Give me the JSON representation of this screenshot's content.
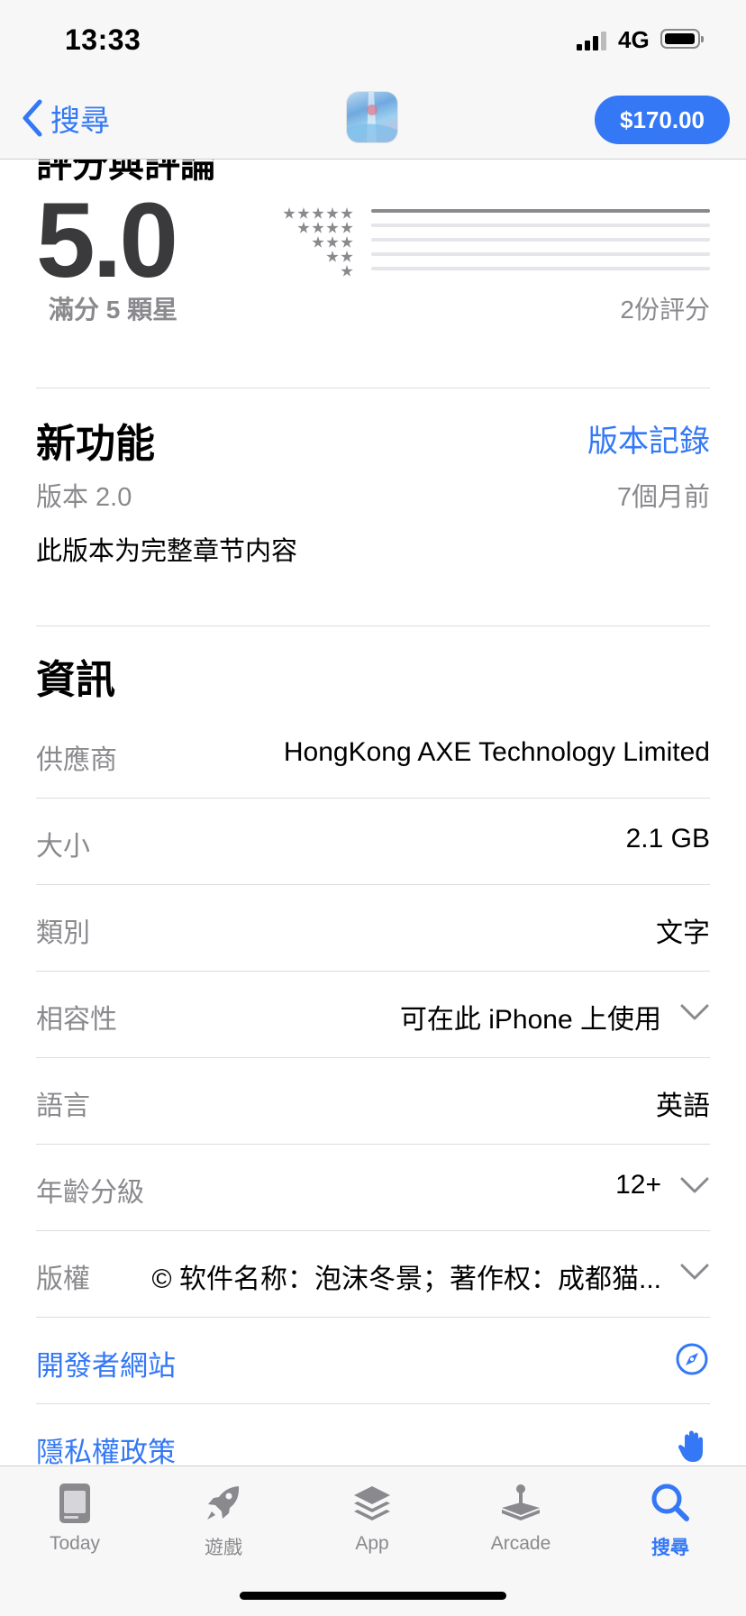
{
  "status_bar": {
    "time": "13:33",
    "network": "4G"
  },
  "nav": {
    "back_label": "搜尋",
    "price": "$170.00"
  },
  "ratings": {
    "section_title": "評分與評論",
    "average": "5.0",
    "out_of": "滿分 5 顆星",
    "count": "2份評分",
    "distribution": [
      {
        "stars": 5,
        "fraction": 1.0
      },
      {
        "stars": 4,
        "fraction": 0.0
      },
      {
        "stars": 3,
        "fraction": 0.0
      },
      {
        "stars": 2,
        "fraction": 0.0
      },
      {
        "stars": 1,
        "fraction": 0.0
      }
    ]
  },
  "whats_new": {
    "title": "新功能",
    "history_link": "版本記錄",
    "version": "版本 2.0",
    "date": "7個月前",
    "notes": "此版本为完整章节内容"
  },
  "info": {
    "title": "資訊",
    "rows": [
      {
        "label": "供應商",
        "value": "HongKong AXE Technology Limited"
      },
      {
        "label": "大小",
        "value": "2.1 GB"
      },
      {
        "label": "類別",
        "value": "文字"
      },
      {
        "label": "相容性",
        "value": "可在此 iPhone 上使用"
      },
      {
        "label": "語言",
        "value": "英語"
      },
      {
        "label": "年齡分級",
        "value": "12+"
      },
      {
        "label": "版權",
        "value": "© 软件名称：泡沫冬景；著作权：成都猫..."
      }
    ],
    "links": [
      {
        "label": "開發者網站",
        "icon": "compass-icon"
      },
      {
        "label": "隱私權政策",
        "icon": "hand-icon"
      }
    ]
  },
  "tabs": [
    {
      "label": "Today",
      "icon": "today-icon",
      "active": false
    },
    {
      "label": "遊戲",
      "icon": "rocket-icon",
      "active": false
    },
    {
      "label": "App",
      "icon": "layers-icon",
      "active": false
    },
    {
      "label": "Arcade",
      "icon": "joystick-icon",
      "active": false
    },
    {
      "label": "搜尋",
      "icon": "search-icon",
      "active": true
    }
  ],
  "colors": {
    "accent": "#3478f6",
    "secondary_text": "#8a8a8e",
    "bar_background": "#f7f7f7"
  }
}
